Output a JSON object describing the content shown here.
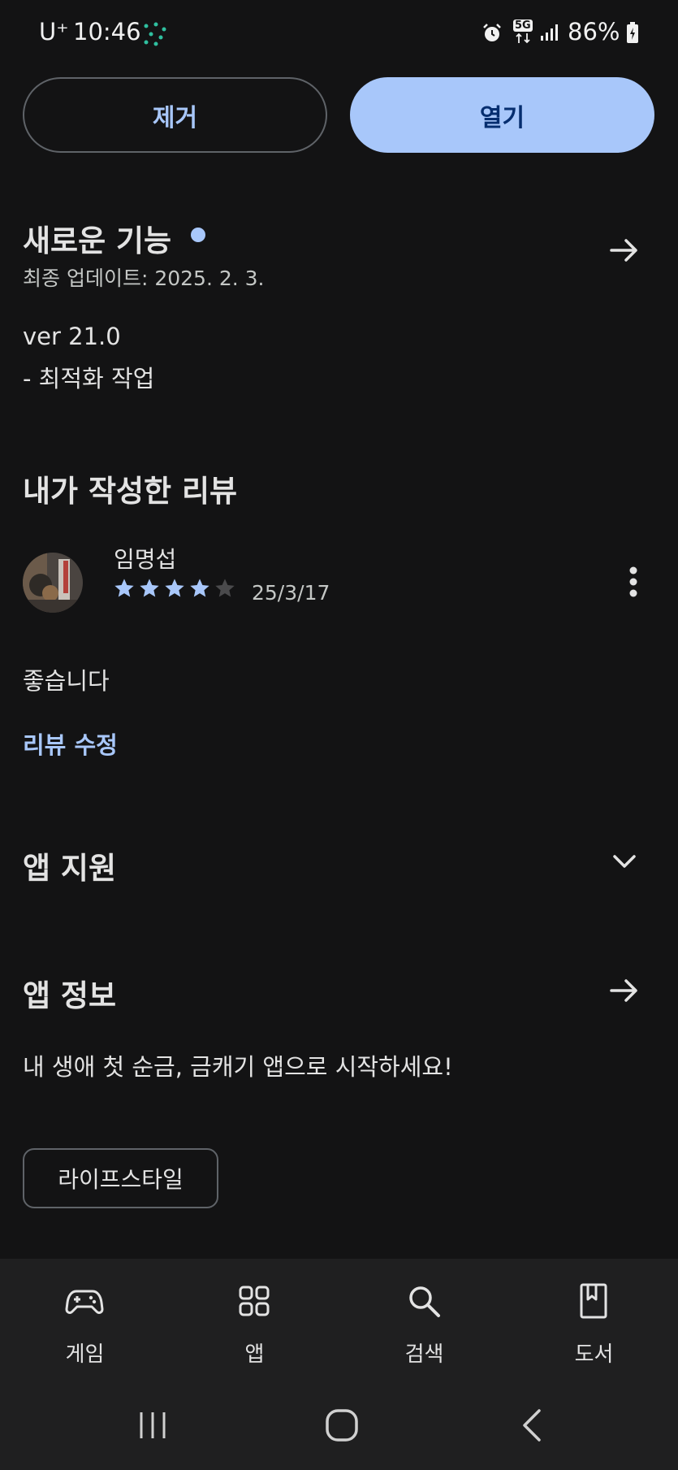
{
  "status_bar": {
    "carrier": "U⁺",
    "time": "10:46",
    "network": "5G",
    "battery": "86%"
  },
  "actions": {
    "remove_label": "제거",
    "open_label": "열기"
  },
  "whats_new": {
    "title": "새로운 기능",
    "last_updated": "최종 업데이트: 2025. 2. 3.",
    "version": "ver 21.0",
    "notes": "- 최적화 작업"
  },
  "my_review": {
    "title": "내가 작성한 리뷰",
    "reviewer": "임명섭",
    "rating": 4,
    "rating_max": 5,
    "date": "25/3/17",
    "body": "좋습니다",
    "edit_label": "리뷰 수정"
  },
  "app_support": {
    "title": "앱 지원"
  },
  "app_info": {
    "title": "앱 정보",
    "description": "내 생애 첫 순금, 금캐기 앱으로 시작하세요!",
    "category": "라이프스타일"
  },
  "bottom_nav": {
    "items": [
      {
        "label": "게임",
        "icon": "gamepad-icon"
      },
      {
        "label": "앱",
        "icon": "apps-grid-icon"
      },
      {
        "label": "검색",
        "icon": "search-icon"
      },
      {
        "label": "도서",
        "icon": "book-icon"
      }
    ]
  },
  "colors": {
    "background": "#131314",
    "accent": "#a8c7fa",
    "open_button_text": "#062e6f"
  }
}
